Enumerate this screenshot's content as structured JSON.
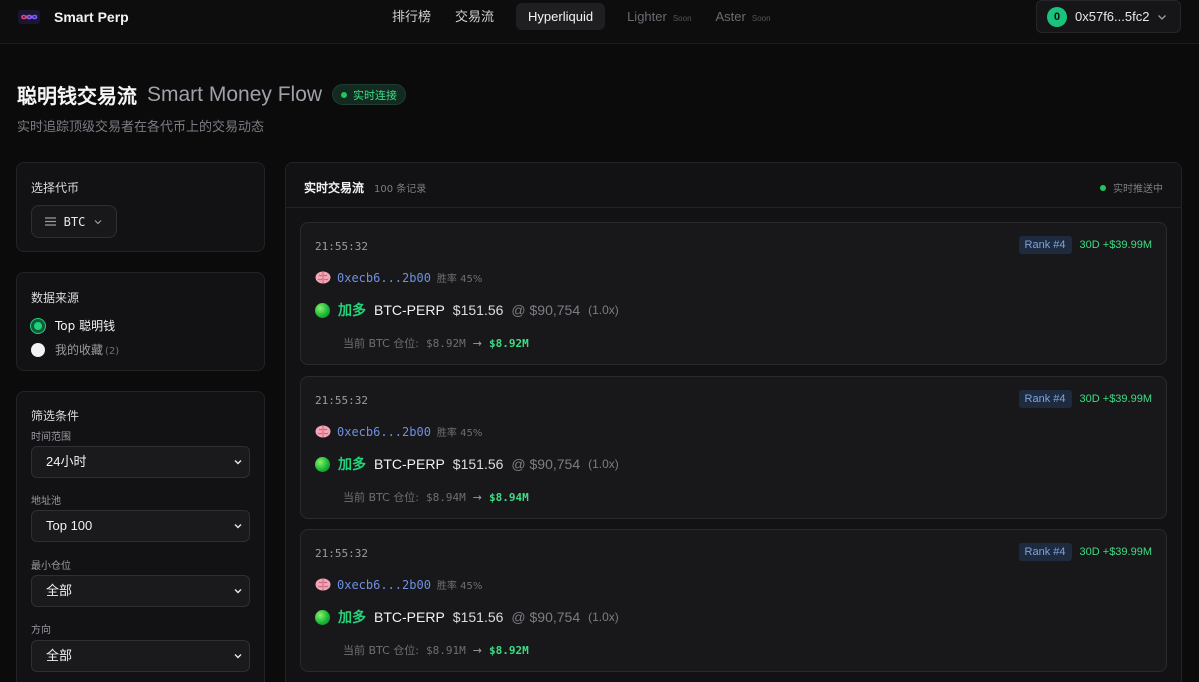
{
  "nav": {
    "brand": "Smart Perp",
    "links": [
      {
        "label": "排行榜"
      },
      {
        "label": "交易流"
      },
      {
        "label": "Hyperliquid",
        "active": true
      },
      {
        "label": "Lighter",
        "badge": "Soon"
      },
      {
        "label": "Aster",
        "badge": "Soon"
      }
    ],
    "wallet": {
      "avatar": "0",
      "address": "0x57f6...5fc2"
    }
  },
  "header": {
    "title_cn": "聪明钱交易流",
    "title_en": "Smart Money Flow",
    "live_badge": "实时连接",
    "subtitle": "实时追踪顶级交易者在各代币上的交易动态"
  },
  "coin_panel": {
    "title": "选择代币",
    "selected": "BTC",
    "icon": "list-icon"
  },
  "source_panel": {
    "title": "数据来源",
    "options": [
      {
        "label": "Top 聪明钱",
        "count": "",
        "selected": true
      },
      {
        "label": "我的收藏",
        "count": "(2)",
        "selected": false
      }
    ]
  },
  "filters": {
    "title": "筛选条件",
    "fields": [
      {
        "label": "时间范围",
        "value": "24小时"
      },
      {
        "label": "地址池",
        "value": "Top 100"
      },
      {
        "label": "最小仓位",
        "value": "全部"
      },
      {
        "label": "方向",
        "value": "全部"
      }
    ]
  },
  "feed": {
    "title": "实时交易流",
    "count": "100 条记录",
    "status": "实时推送中",
    "items": [
      {
        "time": "21:55:32",
        "rank": "Rank #4",
        "pnl": "30D +$39.99M",
        "address": "0xecb6...2b00",
        "winrate": "胜率 45%",
        "side": "加多",
        "pair": "BTC-PERP",
        "amount": "$151.56",
        "price": "@ $90,754",
        "leverage": "(1.0x)",
        "position_label": "当前 BTC 仓位:",
        "position_from": "$8.92M",
        "arrow": "→",
        "position_to": "$8.92M"
      },
      {
        "time": "21:55:32",
        "rank": "Rank #4",
        "pnl": "30D +$39.99M",
        "address": "0xecb6...2b00",
        "winrate": "胜率 45%",
        "side": "加多",
        "pair": "BTC-PERP",
        "amount": "$151.56",
        "price": "@ $90,754",
        "leverage": "(1.0x)",
        "position_label": "当前 BTC 仓位:",
        "position_from": "$8.94M",
        "arrow": "→",
        "position_to": "$8.94M"
      },
      {
        "time": "21:55:32",
        "rank": "Rank #4",
        "pnl": "30D +$39.99M",
        "address": "0xecb6...2b00",
        "winrate": "胜率 45%",
        "side": "加多",
        "pair": "BTC-PERP",
        "amount": "$151.56",
        "price": "@ $90,754",
        "leverage": "(1.0x)",
        "position_label": "当前 BTC 仓位:",
        "position_from": "$8.91M",
        "arrow": "→",
        "position_to": "$8.92M"
      }
    ]
  },
  "colors": {
    "accent_green": "#22d37a",
    "rank_blue": "#7da4e0",
    "address_blue": "#6f8fe0",
    "background": "#0b0b0c"
  }
}
